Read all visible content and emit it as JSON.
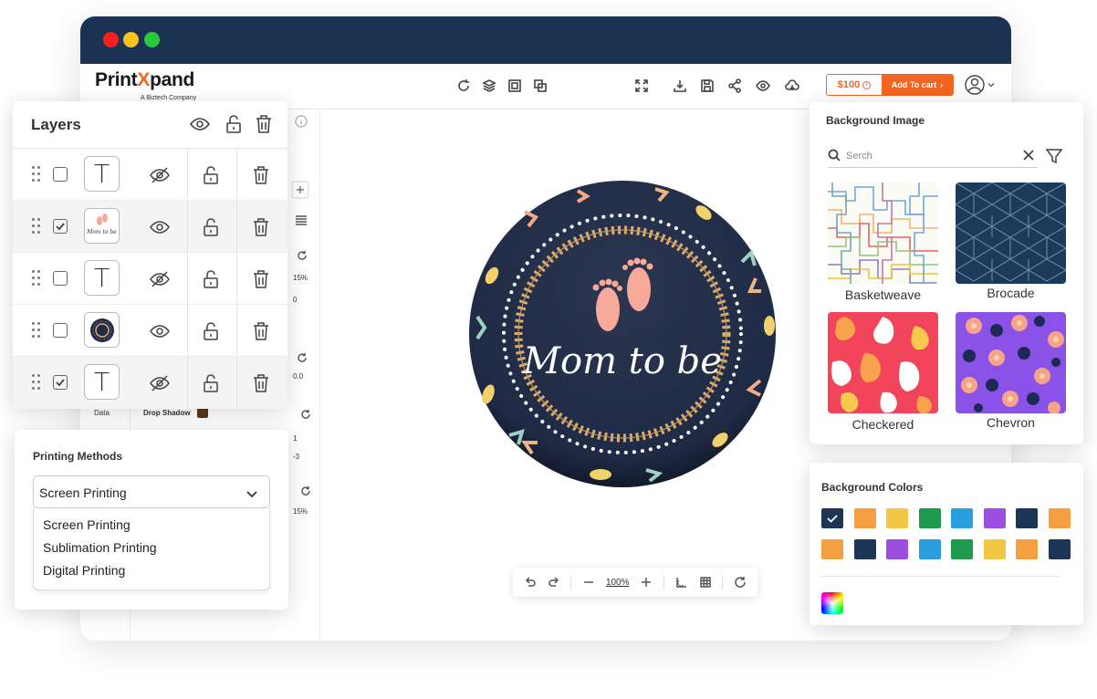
{
  "app": {
    "logo_main_pre": "Print",
    "logo_main_x": "X",
    "logo_main_post": "pand",
    "logo_sub": "A Biztech Company",
    "price": "$100",
    "add_to_cart": "Add To cart"
  },
  "props": {
    "labels": [
      "15%",
      "0",
      "0.0",
      "Data",
      "Drop Shadow",
      "1",
      "-3",
      "15%"
    ],
    "drop_shadow_color": "#5a3719"
  },
  "product": {
    "text": "Mom to be",
    "bg_color": "#1f2a44"
  },
  "zoom": {
    "level": "100%"
  },
  "layers": {
    "title": "Layers",
    "rows": [
      {
        "type": "text",
        "checked": false,
        "visible": false
      },
      {
        "type": "image",
        "checked": true,
        "visible": true
      },
      {
        "type": "text",
        "checked": false,
        "visible": false
      },
      {
        "type": "image-dark",
        "checked": false,
        "visible": true
      },
      {
        "type": "text",
        "checked": true,
        "visible": false
      }
    ],
    "thumb_text": "Mom to be"
  },
  "printing": {
    "title": "Printing Methods",
    "selected": "Screen Printing",
    "options": [
      "Screen Printing",
      "Sublimation Printing",
      "Digital Printing"
    ]
  },
  "background_image": {
    "title": "Background Image",
    "search_placeholder": "Serch",
    "patterns": [
      {
        "label": "Basketweave"
      },
      {
        "label": "Brocade"
      },
      {
        "label": "Checkered"
      },
      {
        "label": "Chevron"
      }
    ]
  },
  "background_colors": {
    "title": "Background Colors",
    "swatches": [
      "#1d3557",
      "#f4a042",
      "#f2c744",
      "#1d9a4c",
      "#2b9ede",
      "#9a4fe0",
      "#1d3557",
      "#f4a042",
      "#f4a042",
      "#1d3557",
      "#9a4fe0",
      "#2b9ede",
      "#1d9a4c",
      "#f2c744",
      "#f4a042",
      "#1d3557"
    ],
    "selected_index": 0
  }
}
